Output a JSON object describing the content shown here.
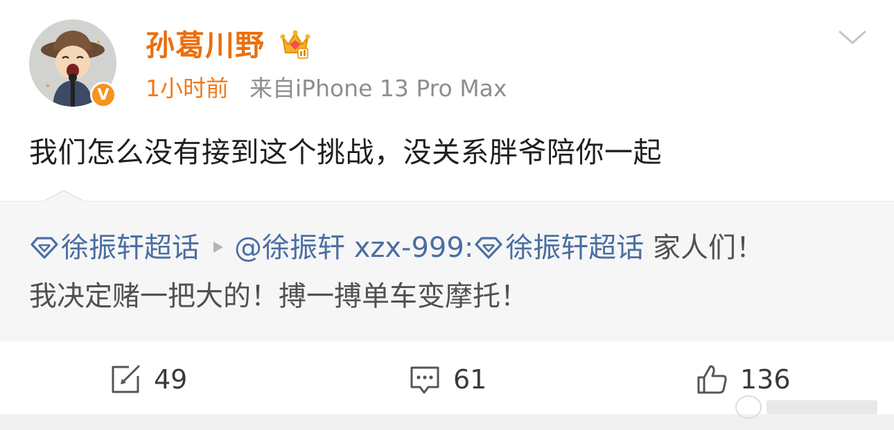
{
  "author": {
    "name": "孙葛川野",
    "verified_badge": "V",
    "badge_color": "#f7931e",
    "name_color": "#ea6f0f"
  },
  "meta": {
    "time": "1小时前",
    "source": "来自iPhone 13 Pro Max"
  },
  "post": {
    "text": "我们怎么没有接到这个挑战，没关系胖爷陪你一起"
  },
  "repost": {
    "topic1": "徐振轩超话",
    "author": "@徐振轩 xzx-999:",
    "topic2": "徐振轩超话",
    "text_line1_end": " 家人们！",
    "text_line2": "我决定赌一把大的！搏一搏单车变摩托！",
    "link_color": "#4b6ea3"
  },
  "actions": {
    "repost_count": "49",
    "comment_count": "61",
    "like_count": "136"
  },
  "icons": [
    "avatar",
    "crown-icon",
    "chevron-down-icon",
    "supertopic-diamond-icon",
    "play-arrow-icon",
    "repost-icon",
    "comment-icon",
    "like-icon",
    "watermark-icon"
  ]
}
